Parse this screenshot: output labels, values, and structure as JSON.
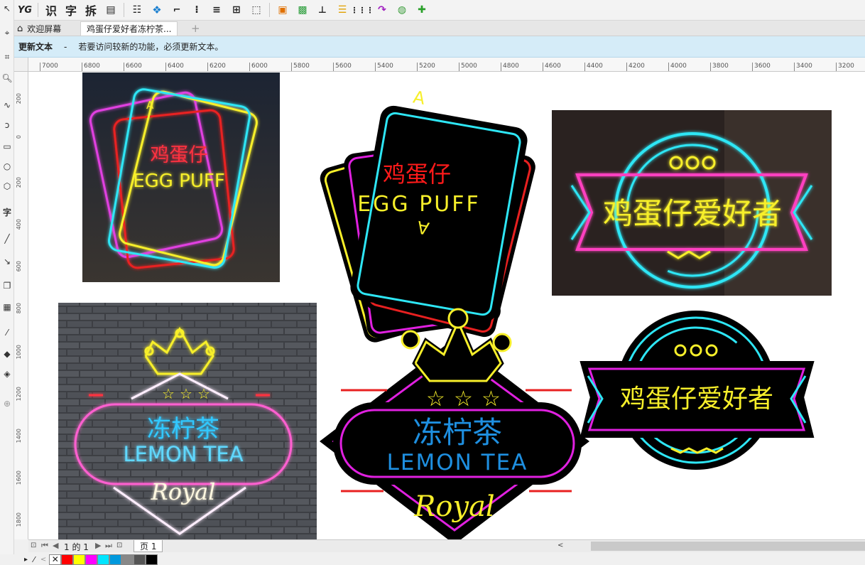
{
  "toolbar": {
    "ocr_label": "识",
    "char_label": "字",
    "split_label": "拆",
    "yg_label": "YG"
  },
  "tabs": [
    {
      "label": "欢迎屏幕"
    },
    {
      "label": "鸡蛋仔爱好者冻柠茶..."
    }
  ],
  "toolbox": {
    "text_tool_label": "字"
  },
  "message": {
    "title": "更新文本",
    "separator": "-",
    "text": "若要访问较新的功能，必须更新文本。"
  },
  "ruler": {
    "h_ticks": [
      "7000",
      "6800",
      "6600",
      "6400",
      "6200",
      "6000",
      "5800",
      "5600",
      "5400",
      "5200",
      "5000",
      "4800",
      "4600",
      "4400",
      "4200",
      "4000",
      "3800",
      "3600",
      "3400",
      "3200"
    ],
    "v_ticks": [
      "200",
      "0",
      "200",
      "400",
      "600",
      "800",
      "1000",
      "1200",
      "1400",
      "1600",
      "1800"
    ]
  },
  "artwork": {
    "card_letter": "A",
    "card_cn": "鸡蛋仔",
    "card_en": "EGG PUFF",
    "badge_cn": "鸡蛋仔爱好者",
    "lemon_cn": "冻柠茶",
    "lemon_en": "LEMON TEA",
    "royal": "Royal",
    "star": "☆"
  },
  "status": {
    "page_of": "1 的 1",
    "page_tab": "页 1"
  },
  "palette": {
    "colors": [
      "#ff0000",
      "#ffff00",
      "#ff00ff",
      "#00e5ff",
      "#0099dd",
      "#888888",
      "#555555",
      "#000000"
    ]
  },
  "colors": {
    "neon_cyan": "#2ee6f5",
    "neon_yellow": "#f7ef2a",
    "neon_magenta": "#e020e0",
    "neon_red": "#e82020",
    "neon_blue": "#1e8fe0"
  }
}
